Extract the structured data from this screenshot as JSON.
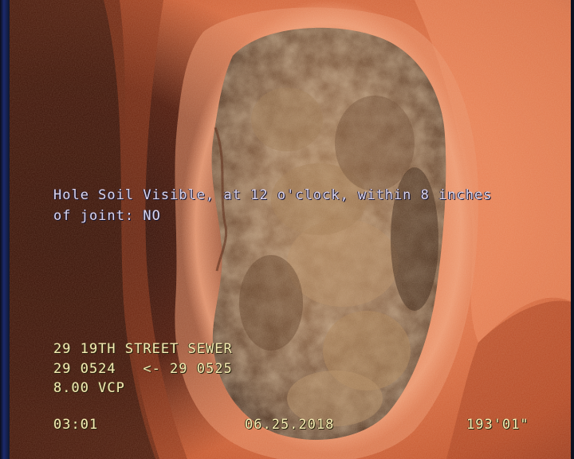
{
  "observation": {
    "line1": "Hole Soil Visible, at 12 o'clock, within 8 inches",
    "line2": "of joint: NO"
  },
  "header_info": {
    "street": "29 19TH STREET SEWER",
    "segment": "29 0524   <- 29 0525",
    "pipe": "8.00 VCP"
  },
  "footer": {
    "timer": "03:01",
    "date": "06.25.2018",
    "distance": "193'01\""
  },
  "colors": {
    "pipe_wall": "#d9683f",
    "cavity_soil": "#7a5232",
    "osd_text": "#f2f2f2",
    "osd_yellow": "#f6ecb4"
  }
}
